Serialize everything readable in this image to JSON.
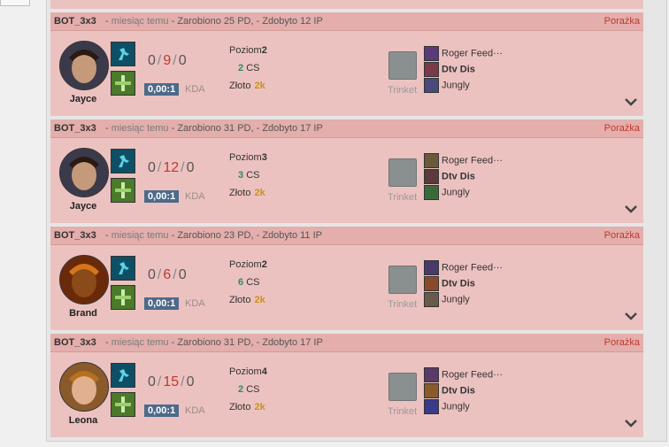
{
  "colors": {
    "match_bg": "#ecc2c0",
    "header_bg": "#e3aeab",
    "loss": "#c0392b",
    "kda_badge": "#4e6a8a",
    "cs": "#2a8a6a",
    "gold": "#c8921a"
  },
  "labels": {
    "level": "Poziom",
    "cs": "CS",
    "gold": "Złoto",
    "kda": "KDA",
    "trinket": "Trinket",
    "sep": " - ",
    "slash": "/"
  },
  "matches": [
    {
      "mode": "BOT_3x3",
      "time": "miesiąc temu",
      "earned": "Zarobiono 25 PD,",
      "ip": "Zdobyto 12 IP",
      "result": "Porażka",
      "champion": "Jayce",
      "champion_icon": "jayce-portrait",
      "kills": "0",
      "deaths": "9",
      "assists": "0",
      "kda_ratio": "0,00:1",
      "level": "2",
      "cs": "2",
      "gold": "2k",
      "players": [
        {
          "name": "Roger Feed···",
          "bold": false,
          "icon": "champion-icon-a",
          "color": "#5a3a7a"
        },
        {
          "name": "Dtv Dis",
          "bold": true,
          "icon": "champion-icon-b",
          "color": "#7a3a4a"
        },
        {
          "name": "Jungly",
          "bold": false,
          "icon": "champion-icon-c",
          "color": "#4a4a7a"
        }
      ]
    },
    {
      "mode": "BOT_3x3",
      "time": "miesiąc temu",
      "earned": "Zarobiono 31 PD,",
      "ip": "Zdobyto 17 IP",
      "result": "Porażka",
      "champion": "Jayce",
      "champion_icon": "jayce-portrait",
      "kills": "0",
      "deaths": "12",
      "assists": "0",
      "kda_ratio": "0,00:1",
      "level": "3",
      "cs": "3",
      "gold": "2k",
      "players": [
        {
          "name": "Roger Feed···",
          "bold": false,
          "icon": "champion-icon-d",
          "color": "#6a5a3a"
        },
        {
          "name": "Dtv Dis",
          "bold": true,
          "icon": "champion-icon-e",
          "color": "#5a3a3a"
        },
        {
          "name": "Jungly",
          "bold": false,
          "icon": "champion-icon-f",
          "color": "#3a6a3a"
        }
      ]
    },
    {
      "mode": "BOT_3x3",
      "time": "miesiąc temu",
      "earned": "Zarobiono 23 PD,",
      "ip": "Zdobyto 11 IP",
      "result": "Porażka",
      "champion": "Brand",
      "champion_icon": "brand-portrait",
      "kills": "0",
      "deaths": "6",
      "assists": "0",
      "kda_ratio": "0,00:1",
      "level": "2",
      "cs": "6",
      "gold": "2k",
      "players": [
        {
          "name": "Roger Feed···",
          "bold": false,
          "icon": "champion-icon-g",
          "color": "#4a3a6a"
        },
        {
          "name": "Dtv Dis",
          "bold": true,
          "icon": "champion-icon-h",
          "color": "#8a4a2a"
        },
        {
          "name": "Jungly",
          "bold": false,
          "icon": "champion-icon-i",
          "color": "#6a5a4a"
        }
      ]
    },
    {
      "mode": "BOT_3x3",
      "time": "miesiąc temu",
      "earned": "Zarobiono 31 PD,",
      "ip": "Zdobyto 17 IP",
      "result": "Porażka",
      "champion": "Leona",
      "champion_icon": "leona-portrait",
      "kills": "0",
      "deaths": "15",
      "assists": "0",
      "kda_ratio": "0,00:1",
      "level": "4",
      "cs": "2",
      "gold": "2k",
      "players": [
        {
          "name": "Roger Feed···",
          "bold": false,
          "icon": "champion-icon-j",
          "color": "#5a3a6a"
        },
        {
          "name": "Dtv Dis",
          "bold": true,
          "icon": "champion-icon-k",
          "color": "#8a5a2a"
        },
        {
          "name": "Jungly",
          "bold": false,
          "icon": "champion-icon-l",
          "color": "#3a3a8a"
        }
      ]
    }
  ]
}
